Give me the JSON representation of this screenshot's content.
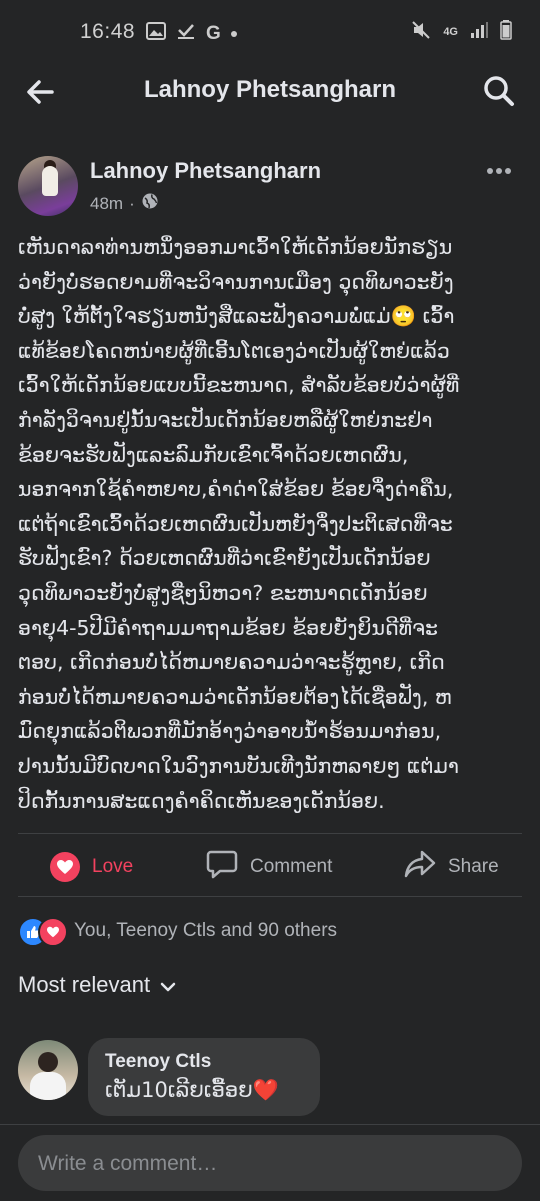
{
  "status_bar": {
    "time": "16:48",
    "left_icons": [
      "image-icon",
      "check-icon",
      "google-icon",
      "dot-icon"
    ],
    "right_icons": [
      "mute-icon",
      "4g-icon",
      "signal-icon",
      "battery-icon"
    ],
    "network_label": "4G"
  },
  "header": {
    "title": "Lahnoy Phetsangharn",
    "back_icon": "arrow-left-icon",
    "search_icon": "search-icon"
  },
  "post": {
    "author": "Lahnoy Phetsangharn",
    "time": "48m",
    "privacy_icon": "globe-icon",
    "lines": [
      "ເຫັນດາລາທ່ານຫນຶ່ງອອກມາເວົ້າໃຫ້ເດັກນ້ອຍນັກຮຽນ",
      "ວ່າຍັງບໍ່ຮອດຍາມທີ່ຈະວິຈານການເມືອງ ວຸດທິພາວະຍັງ",
      "ບໍ່ສູງ ໃຫ້ຕັ້ງໃຈຮຽນຫນັງສືແລະຟັງຄວາມພໍ່ແມ່🙄 ເວົ້າ",
      "ແທ້ຂ້ອຍໂຄດຫນ່າຍຜູ້ທີ່ເອີ້ນໂຕເອງວ່າເປັນຜູ້ໃຫຍ່ແລ້ວ",
      "ເວົ້າໃຫ້ເດັກນ້ອຍແບບນີ້ຂະຫນາດ, ສຳລັບຂ້ອຍບໍ່ວ່າຜູ້ທີ່",
      "ກຳລັງວິຈານຢູ່ນັ້ນຈະເປັນເດັກນ້ອຍຫລືຜູ້ໃຫຍ່ກະຢ່າ",
      "ຂ້ອຍຈະຮັບຟັງແລະລົມກັບເຂົາເຈົ້າດ້ວຍເຫດຜົນ,",
      "ນອກຈາກໃຊ້ຄຳຫຍາບ,ຄຳດ່າໃສ່ຂ້ອຍ ຂ້ອຍຈຶ່ງດ່າຄືນ,",
      "ແຕ່ຖ້າເຂົາເວົ້າດ້ວຍເຫດຜົນເປັນຫຍັງຈຶ່ງປະຕິເສດທີ່ຈະ",
      "ຮັບຟັງເຂົາ? ດ້ວຍເຫດຜົນທີ່ວ່າເຂົາຍັງເປັນເດັກນ້ອຍ",
      "ວຸດທິພາວະຍັງບໍ່ສູງຊື່ໆນິຫວາ? ຂະຫນາດເດັກນ້ອຍ",
      "ອາຍຸ4-5ປີມີຄຳຖາມມາຖາມຂ້ອຍ ຂ້ອຍຍັງຍິນດີທີ່ຈະ",
      "ຕອບ, ເກີດກ່ອນບໍ່ໄດ້ຫມາຍຄວາມວ່າຈະຮູ້ຫຼາຍ, ເກີດ",
      "ກ່ອນບໍ່ໄດ້ຫມາຍຄວາມວ່າເດັກນ້ອຍຕ້ອງໄດ້ເຊື່ອຟັງ, ຫ",
      "ມົດຍຸກແລ້ວຕິພວກທີ່ມັກອ້າງວ່າອາບນ້ຳຮ້ອນມາກ່ອນ,",
      "ປານນັ້ນມີບົດບາດໃນວົງການບັນເທີງນັກຫລາຍໆ ແຕ່ມາ",
      "ປິດກັ້ນການສະແດງຄຳຄິດເຫັນຂອງເດັກນ້ອຍ."
    ]
  },
  "actions": {
    "love_label": "Love",
    "comment_label": "Comment",
    "share_label": "Share"
  },
  "reactions": {
    "summary": "You, Teenoy Ctls and 90 others"
  },
  "sort": {
    "label": "Most relevant"
  },
  "comments": [
    {
      "name": "Teenoy Ctls",
      "text": "ເຕັມ10ເລີຍເອື້ອຍ",
      "emoji": "❤️"
    }
  ],
  "composer": {
    "placeholder": "Write a comment…"
  },
  "colors": {
    "background": "#242526",
    "bubble": "#3a3b3c",
    "love": "#f3425f",
    "like": "#2d88ff",
    "text": "#e4e6eb",
    "muted": "#b0b3b8"
  }
}
